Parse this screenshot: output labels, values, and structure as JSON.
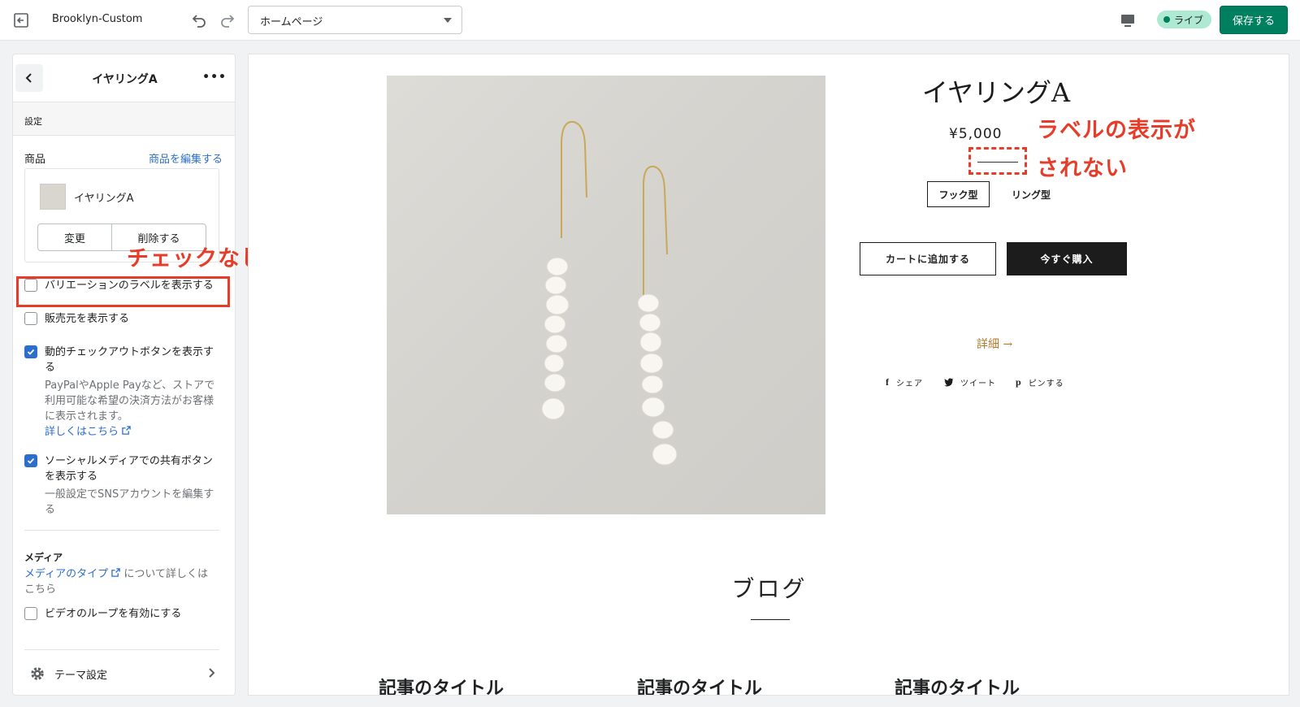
{
  "topbar": {
    "theme_name": "Brooklyn-Custom",
    "page_select_value": "ホームページ",
    "status_label": "ライブ",
    "save_label": "保存する"
  },
  "sidebar": {
    "title": "イヤリングA",
    "section_label": "設定",
    "product_label": "商品",
    "edit_product_link": "商品を編集する",
    "product_name": "イヤリングA",
    "change_button": "変更",
    "delete_button": "削除する",
    "show_variant_labels": {
      "label": "バリエーションのラベルを表示する",
      "checked": false
    },
    "show_vendor": {
      "label": "販売元を表示する",
      "checked": false
    },
    "dynamic_checkout": {
      "label_line1": "動的チェックアウトボタンを表示す",
      "label_line2": "る",
      "checked": true,
      "help_line1": "PayPalやApple Payなど、ストアで",
      "help_line2": "利用可能な希望の決済方法がお客様",
      "help_line3": "に表示されます。",
      "help_link": "詳しくはこちら"
    },
    "social_sharing": {
      "label_line1": "ソーシャルメディアでの共有ボタン",
      "label_line2": "を表示する",
      "checked": true,
      "help_line1": "一般設定でSNSアカウントを編集す",
      "help_line2": "る"
    },
    "media_title": "メディア",
    "media_link": "メディアのタイプ",
    "media_text_rest": "について詳しくは",
    "media_text_line2": "こちら",
    "video_loop": {
      "label": "ビデオのループを有効にする",
      "checked": false
    },
    "theme_settings": "テーマ設定"
  },
  "annotations": {
    "unchecked_note": "チェックなし",
    "label_note_line1": "ラベルの表示が",
    "label_note_line2": "されない",
    "color": "#e53d2a"
  },
  "preview": {
    "product_title": "イヤリングA",
    "price": "¥5,000",
    "variants": [
      "フック型",
      "リング型"
    ],
    "add_to_cart": "カートに追加する",
    "buy_now": "今すぐ購入",
    "details_link": "詳細 →",
    "share": {
      "facebook": "シェア",
      "twitter": "ツイート",
      "pinterest": "ピンする"
    },
    "blog_heading": "ブログ",
    "article_titles": [
      "記事のタイトル",
      "記事のタイトル",
      "記事のタイトル"
    ]
  }
}
